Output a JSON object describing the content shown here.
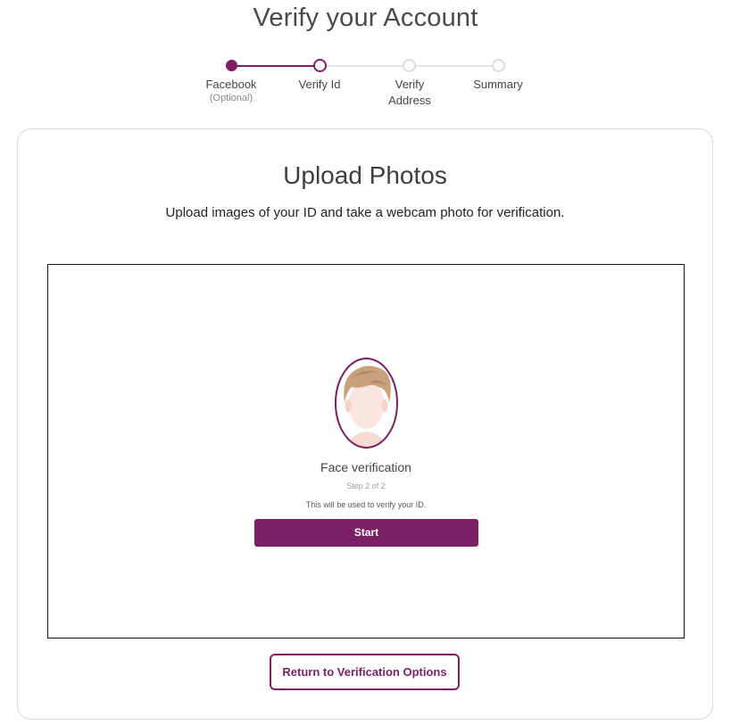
{
  "header": {
    "title": "Verify your Account"
  },
  "stepper": {
    "steps": [
      {
        "label": "Facebook",
        "sublabel": "(Optional)",
        "state": "complete"
      },
      {
        "label": "Verify Id",
        "sublabel": "",
        "state": "current"
      },
      {
        "label": "Verify",
        "label_line2": "Address",
        "sublabel": "",
        "state": "upcoming"
      },
      {
        "label": "Summary",
        "sublabel": "",
        "state": "upcoming"
      }
    ],
    "active_color": "#7d1f65",
    "inactive_color": "#dcdcdc"
  },
  "upload": {
    "title": "Upload Photos",
    "subtitle": "Upload images of your ID and take a webcam photo for verification.",
    "capture": {
      "icon": "face-avatar-icon",
      "title": "Face verification",
      "step_text": "Step 2 of 2",
      "note": "This will be used to verify your ID.",
      "start_label": "Start"
    },
    "return_label": "Return to Verification Options"
  },
  "colors": {
    "brand": "#7d1f65",
    "border": "#d9d9d9"
  }
}
